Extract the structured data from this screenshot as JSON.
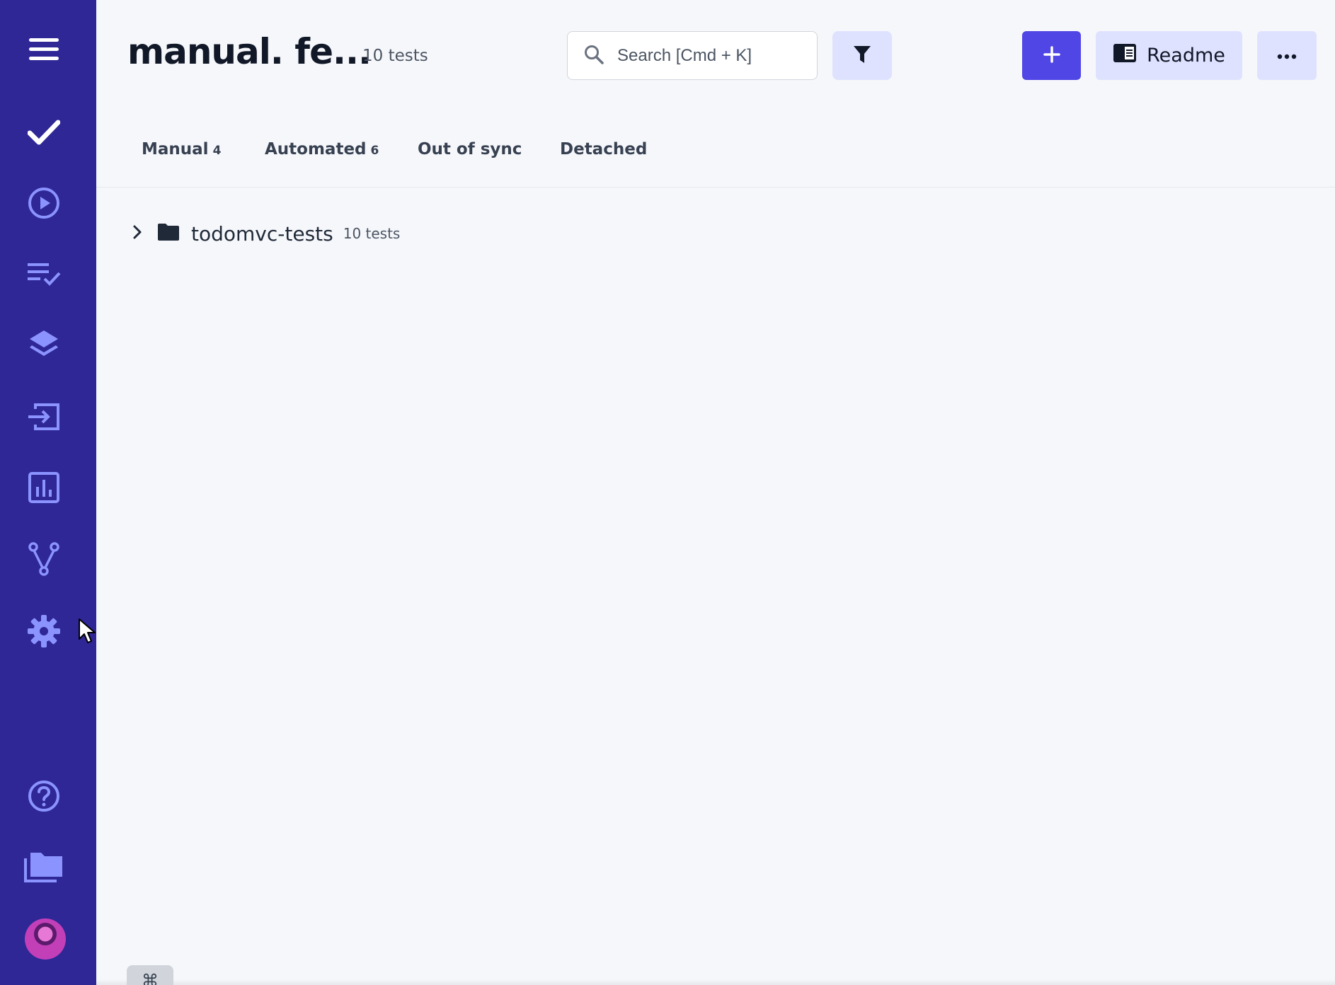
{
  "header": {
    "title": "manual. fe...",
    "test_count": "10 tests",
    "search_placeholder": "Search [Cmd + K]",
    "readme_label": "Readme",
    "add_label": "+",
    "more_label": "..."
  },
  "tabs": [
    {
      "label": "Manual",
      "count": "4"
    },
    {
      "label": "Automated",
      "count": "6"
    },
    {
      "label": "Out of sync",
      "count": ""
    },
    {
      "label": "Detached",
      "count": ""
    }
  ],
  "tree": [
    {
      "name": "todomvc-tests",
      "count": "10 tests"
    }
  ],
  "sidebar": {
    "items": [
      "menu-icon",
      "checkmark-icon",
      "play-icon",
      "checklist-icon",
      "layers-icon",
      "import-icon",
      "analytics-icon",
      "branch-icon",
      "gear-icon"
    ],
    "bottom_items": [
      "help-icon",
      "projects-icon",
      "avatar"
    ]
  },
  "footer": {
    "shortcut_key": "⌘"
  },
  "colors": {
    "sidebar": "#2f2796",
    "sidebar_icon": "#8b93ff",
    "primary": "#4f46e5",
    "secondary_button": "#dfe2ff",
    "background": "#f6f7fb"
  }
}
